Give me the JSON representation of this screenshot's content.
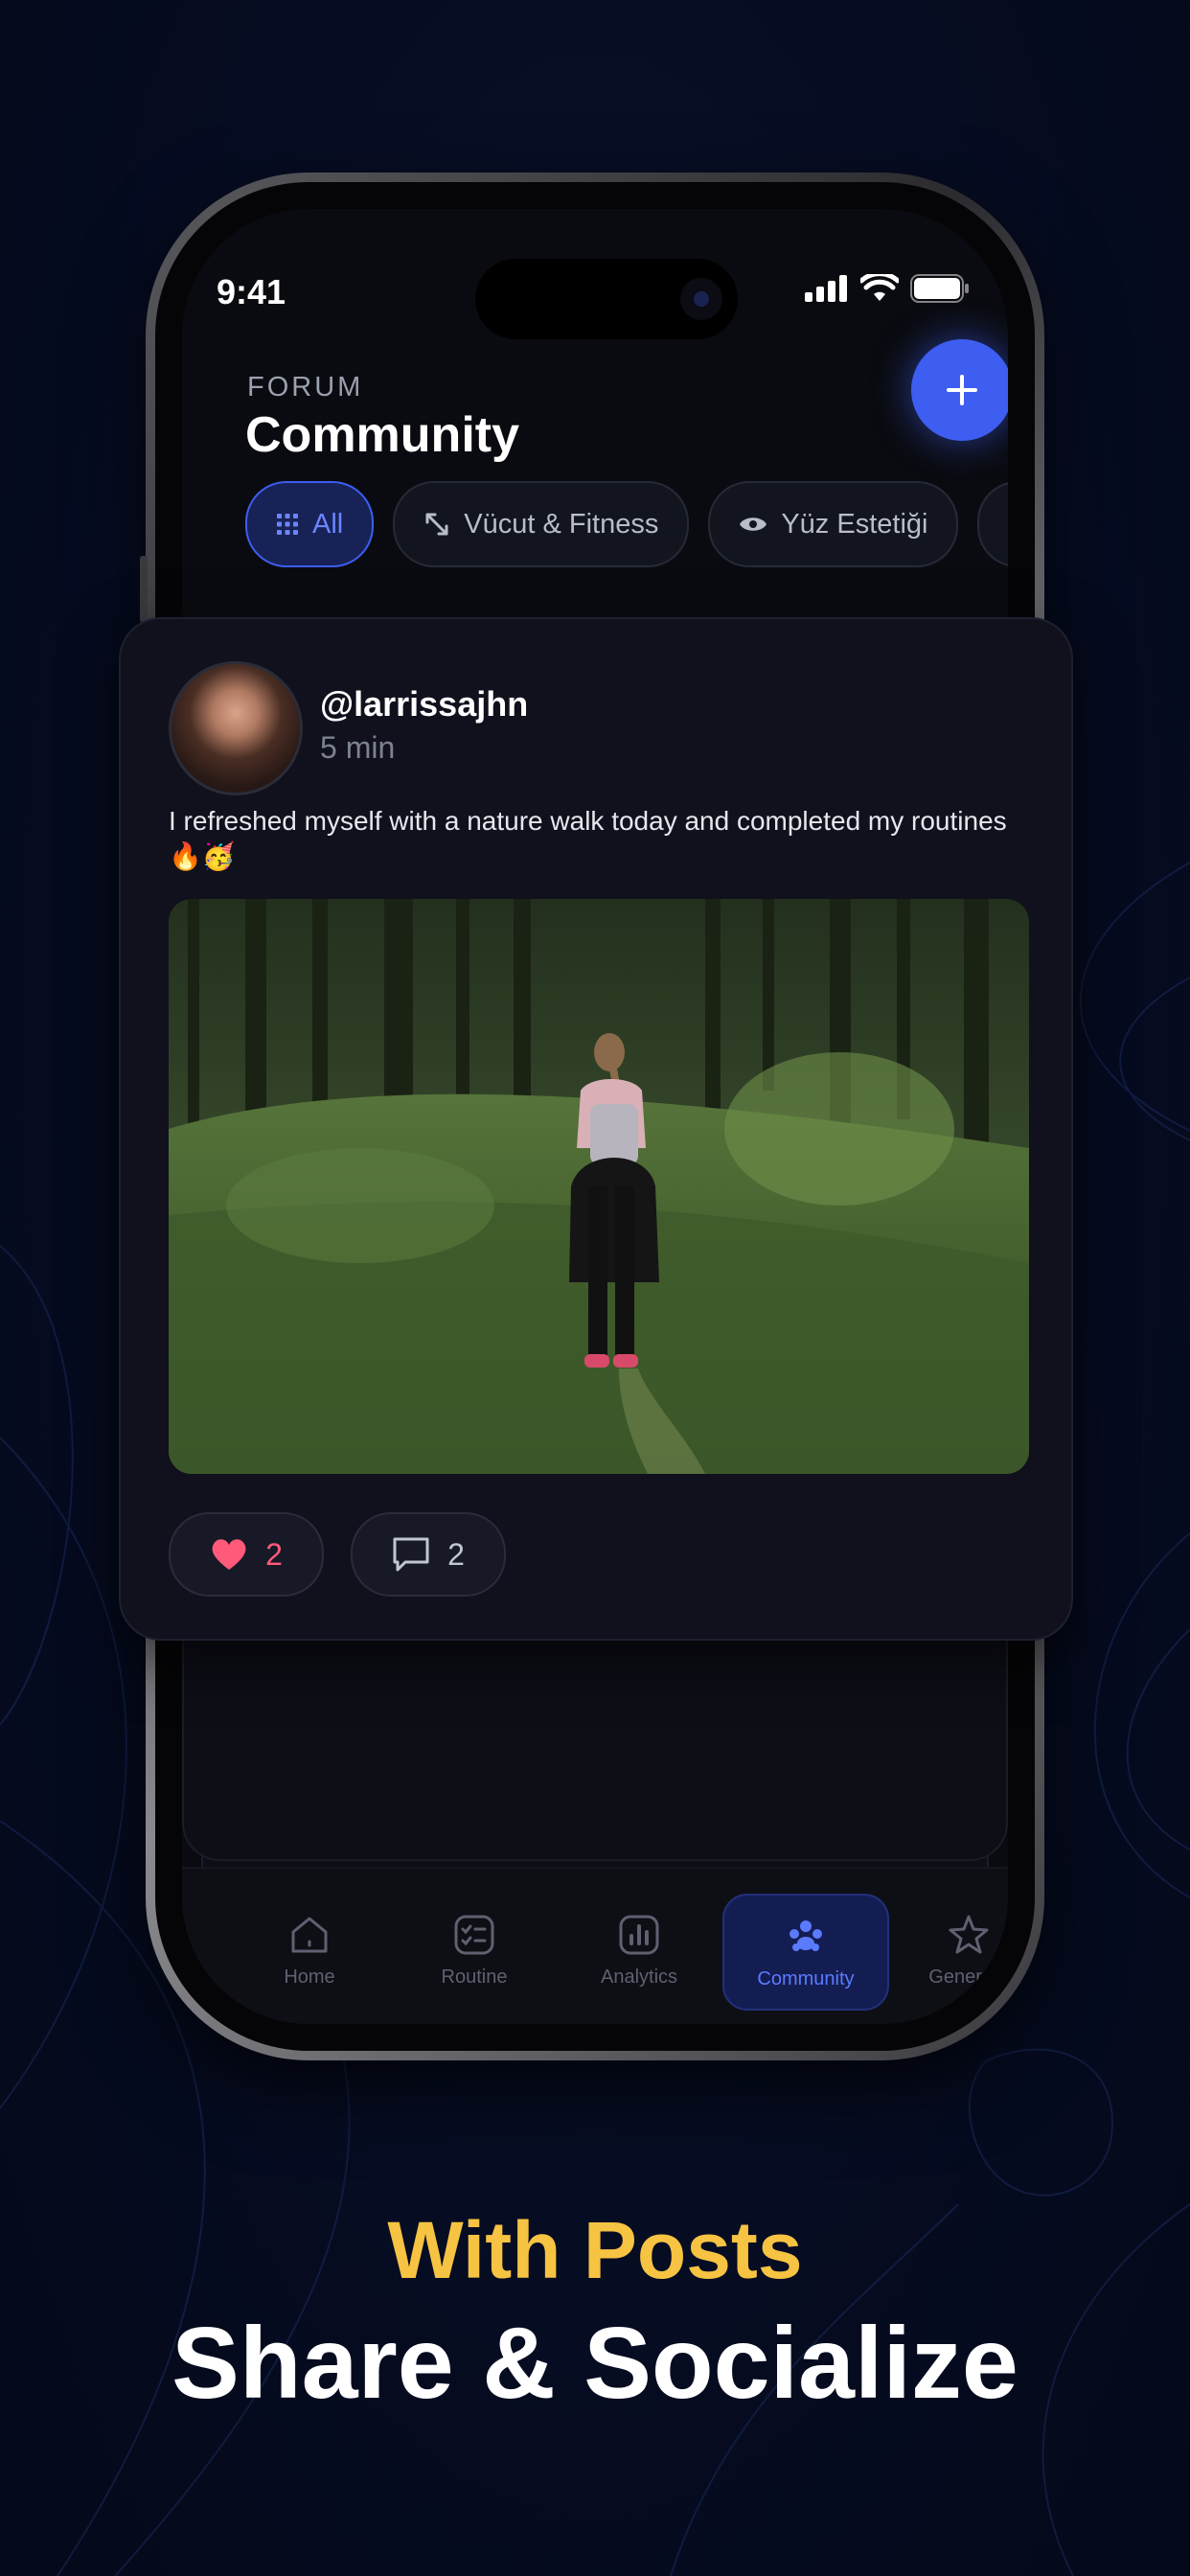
{
  "status": {
    "time": "9:41"
  },
  "header": {
    "section_label": "FORUM",
    "title": "Community"
  },
  "filters": [
    {
      "label": "All",
      "icon": "grid-icon",
      "active": true
    },
    {
      "label": "Vücut & Fitness",
      "icon": "resize-arrows-icon",
      "active": false
    },
    {
      "label": "Yüz Estetiği",
      "icon": "eye-icon",
      "active": false
    }
  ],
  "post": {
    "username": "@larrissajhn",
    "time_ago": "5 min",
    "text": "I refreshed myself with a nature walk today and completed my routines🔥🥳",
    "likes": "2",
    "comments": "2"
  },
  "tabs": [
    {
      "label": "Home",
      "icon": "home-icon"
    },
    {
      "label": "Routine",
      "icon": "checklist-icon"
    },
    {
      "label": "Analytics",
      "icon": "analytics-icon"
    },
    {
      "label": "Community",
      "icon": "community-icon",
      "active": true
    },
    {
      "label": "Generate",
      "icon": "sparkle-icon"
    }
  ],
  "headline": {
    "line1": "With Posts",
    "line2": "Share & Socialize"
  },
  "colors": {
    "accent": "#3d5ef0",
    "headline_accent": "#f6c342",
    "like": "#ff5a7a"
  }
}
